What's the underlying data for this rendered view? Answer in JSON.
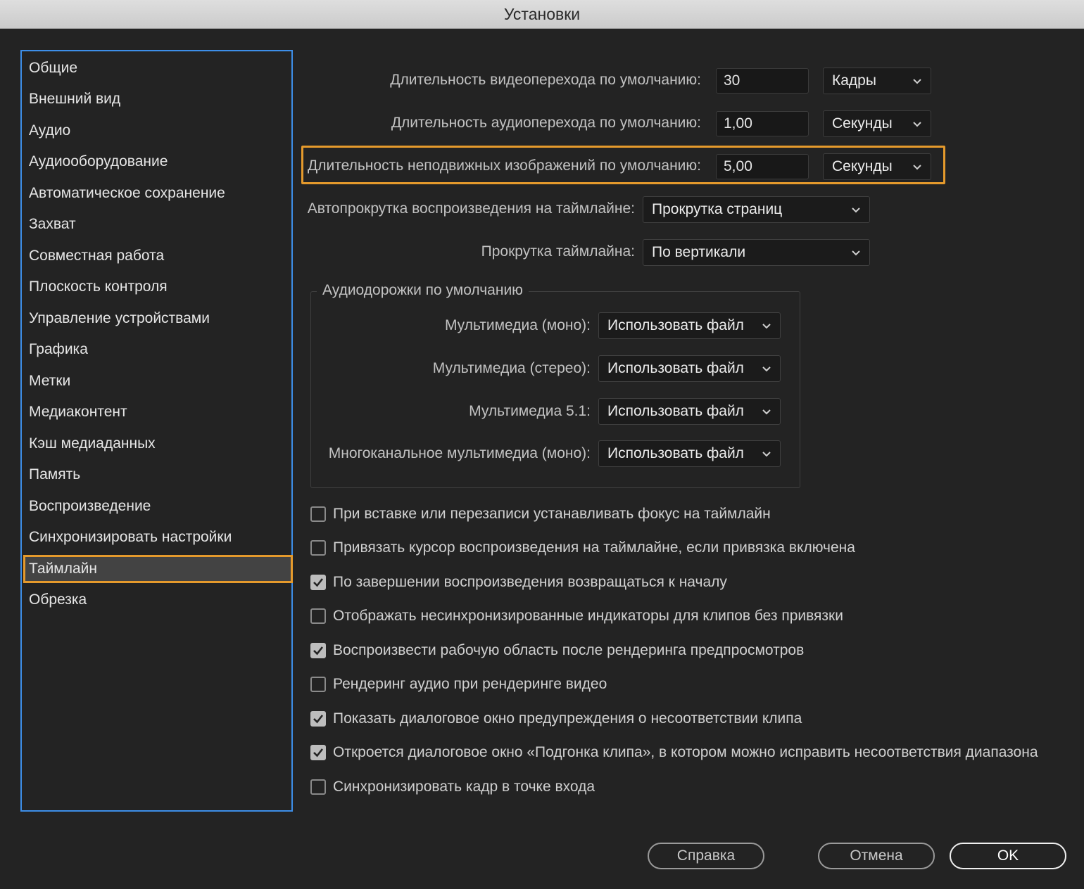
{
  "window": {
    "title": "Установки"
  },
  "sidebar": {
    "items": [
      "Общие",
      "Внешний вид",
      "Аудио",
      "Аудиооборудование",
      "Автоматическое сохранение",
      "Захват",
      "Совместная работа",
      "Плоскость контроля",
      "Управление устройствами",
      "Графика",
      "Метки",
      "Медиаконтент",
      "Кэш медиаданных",
      "Память",
      "Воспроизведение",
      "Синхронизировать настройки",
      "Таймлайн",
      "Обрезка"
    ],
    "selected": "Таймлайн"
  },
  "settings": {
    "video_transition": {
      "label": "Длительность видеоперехода по умолчанию:",
      "value": "30",
      "unit": "Кадры"
    },
    "audio_transition": {
      "label": "Длительность аудиоперехода по умолчанию:",
      "value": "1,00",
      "unit": "Секунды"
    },
    "still_image": {
      "label": "Длительность неподвижных изображений по умолчанию:",
      "value": "5,00",
      "unit": "Секунды"
    },
    "autoscroll": {
      "label": "Автопрокрутка воспроизведения на таймлайне:",
      "value": "Прокрутка страниц"
    },
    "timeline_scroll": {
      "label": "Прокрутка таймлайна:",
      "value": "По вертикали"
    }
  },
  "audio_tracks": {
    "title": "Аудиодорожки по умолчанию",
    "rows": [
      {
        "label": "Мультимедиа (моно):",
        "value": "Использовать файл"
      },
      {
        "label": "Мультимедиа (стерео):",
        "value": "Использовать файл"
      },
      {
        "label": "Мультимедиа 5.1:",
        "value": "Использовать файл"
      },
      {
        "label": "Многоканальное мультимедиа (моно):",
        "value": "Использовать файл"
      }
    ]
  },
  "checkboxes": [
    {
      "label": "При вставке или перезаписи устанавливать фокус на таймлайн",
      "checked": false
    },
    {
      "label": "Привязать курсор воспроизведения на таймлайне, если привязка включена",
      "checked": false
    },
    {
      "label": "По завершении воспроизведения возвращаться к началу",
      "checked": true
    },
    {
      "label": "Отображать несинхронизированные индикаторы для клипов без привязки",
      "checked": false
    },
    {
      "label": "Воспроизвести рабочую область после рендеринга предпросмотров",
      "checked": true
    },
    {
      "label": "Рендеринг аудио при рендеринге видео",
      "checked": false
    },
    {
      "label": "Показать диалоговое окно предупреждения о несоответствии клипа",
      "checked": true
    },
    {
      "label": "Откроется диалоговое окно «Подгонка клипа», в котором можно исправить несоответствия диапазона",
      "checked": true
    },
    {
      "label": "Синхронизировать кадр в точке входа",
      "checked": false
    }
  ],
  "buttons": {
    "help": "Справка",
    "cancel": "Отмена",
    "ok": "OK"
  },
  "colors": {
    "accent_highlight": "#e59a2c",
    "sidebar_border": "#3d8ee8",
    "background": "#232323"
  }
}
